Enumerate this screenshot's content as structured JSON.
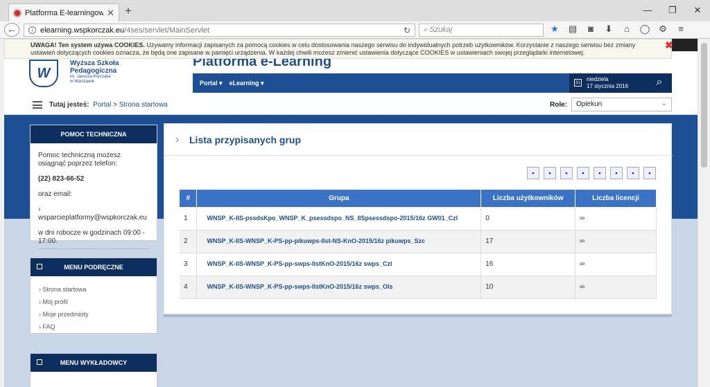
{
  "browser": {
    "tab_title": "Platforma E-learningowa ...",
    "url_host": "elearning.wspkorczak.eu",
    "url_path": "/4ses/servlet/MainServlet",
    "search_placeholder": "Szukaj"
  },
  "cookie": {
    "bold": "UWAGA! Ten system używa COOKIES.",
    "text": " Używamy informacji zapisanych za pomocą cookies w celu dostosowania naszego serwisu do indywidualnych potrzeb użytkowników. Korzystanie z naszego serwisu bez zmiany ustawień dotyczących cookies oznacza, że będą one zapisane w pamięci urządzenia. W każdej chwili możesz zmienić ustawienia dotyczące COOKIES w ustawieniach swojej przeglądarki internetowej."
  },
  "header": {
    "school_line1": "Wyższa Szkoła",
    "school_line2": "Pedagogiczna",
    "school_line3": "im. Janusza Korczaka",
    "school_line4": "w Warszawie",
    "platform_title": "Platforma e-Learning",
    "menu_portal": "Portal ▾",
    "menu_elearning": "eLearning ▾",
    "date_day": "niedziela",
    "date_full": "17 stycznia 2016"
  },
  "breadcrumb": {
    "label": "Tutaj jesteś:",
    "items": [
      "Portal",
      "Strona startowa"
    ]
  },
  "role": {
    "label": "Role:",
    "value": "Opiekun"
  },
  "sidebar": {
    "help_title": "POMOC TECHNICZNA",
    "help_text1": "Pomoc techniczną możesz osiągnąć poprzez telefon:",
    "help_phone": "(22) 823-66-52",
    "help_text2": "oraz email:",
    "help_email": "wsparcieplatformy@wspkorczak.eu",
    "help_hours": "w dni robocze w godzinach 09:00 - 17:00.",
    "quick_title": "MENU PODRĘCZNE",
    "quick_items": [
      "Strona startowa",
      "Mój profil",
      "Moje przedmioty",
      "FAQ"
    ],
    "lect_title": "MENU WYKŁADOWCY"
  },
  "main": {
    "title": "Lista przypisanych grup",
    "table": {
      "headers": [
        "#",
        "Grupa",
        "Liczba użytkowników",
        "Liczba licencji"
      ],
      "rows": [
        [
          "1",
          "WNSP_K-IIS-pssdsKpo_WNSP_K_psessdspo_NS_IISpsessdspo-2015/16z GW01_Czl",
          "0",
          "∞"
        ],
        [
          "2",
          "WNSP_K-IIS-WNSP_K-PS-pp-pikuwps-IIst-NS-KnO-2015/16z pikuwps_Szc",
          "17",
          "∞"
        ],
        [
          "3",
          "WNSP_K-IIS-WNSP_K-PS-pp-swps-IIstKnO-2015/16z swps_Czl",
          "16",
          "∞"
        ],
        [
          "4",
          "WNSP_K-IIS-WNSP_K-PS-pp-swps-IIstKnO-2015/16z swps_Ols",
          "10",
          "∞"
        ]
      ]
    }
  }
}
